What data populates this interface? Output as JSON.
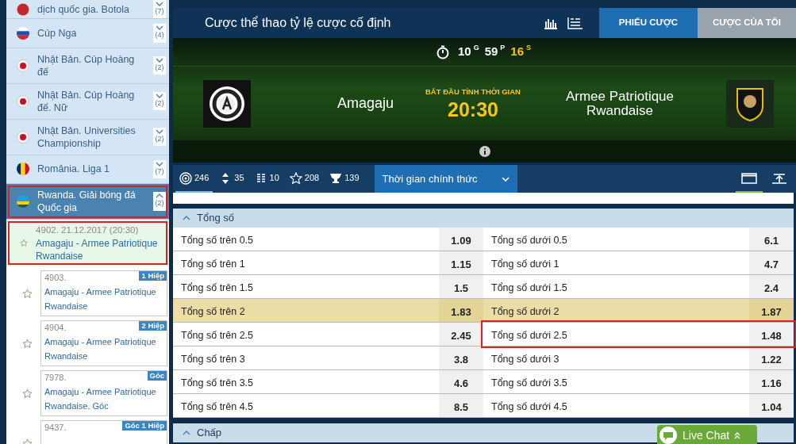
{
  "sidebar": {
    "leagues": [
      {
        "name": "dịch quốc gia. Botola",
        "count": "(7)",
        "kind": "morocco",
        "expanded": false,
        "selected": false,
        "outlined": false
      },
      {
        "name": "Cúp Nga",
        "count": "(4)",
        "kind": "russia",
        "expanded": false,
        "selected": false,
        "outlined": false
      },
      {
        "name": "Nhật Bản. Cúp Hoàng đế",
        "count": "(2)",
        "kind": "japan",
        "expanded": false,
        "selected": false,
        "outlined": false
      },
      {
        "name": "Nhật Bản. Cúp Hoàng đế. Nữ",
        "count": "(2)",
        "kind": "japan",
        "expanded": false,
        "selected": false,
        "outlined": false
      },
      {
        "name": "Nhật Bản. Universities Championship",
        "count": "(2)",
        "kind": "japan",
        "expanded": false,
        "selected": false,
        "outlined": false
      },
      {
        "name": "România. Liga 1",
        "count": "(7)",
        "kind": "romania",
        "expanded": false,
        "selected": false,
        "outlined": false
      },
      {
        "name": "Rwanda. Giải bóng đá Quốc gia",
        "count": "(2)",
        "kind": "rwanda",
        "expanded": true,
        "selected": true,
        "outlined": true
      }
    ],
    "main_match": {
      "code": "4902. 21.12.2017 (20:30)",
      "teams": "Amagaju - Armee Patriotique Rwandaise",
      "selected": true,
      "outlined": true
    },
    "sub_matches": [
      {
        "code": "4903.",
        "teams": "Amagaju - Armee Patriotique Rwandaise",
        "tag": "1 Hiệp"
      },
      {
        "code": "4904.",
        "teams": "Amagaju - Armee Patriotique Rwandaise",
        "tag": "2 Hiệp"
      },
      {
        "code": "7978.",
        "teams": "Amagaju - Armee Patriotique Rwandaise. Góc",
        "tag": "Góc"
      },
      {
        "code": "9437.",
        "tag": "Góc 1 Hiệp"
      }
    ]
  },
  "header": {
    "title": "Cược thể thao tỷ lệ cược cố định",
    "tabs": [
      {
        "label": "PHIẾU CƯỢC",
        "selected": true
      },
      {
        "label": "CƯỢC CỦA TÔI",
        "selected": false
      }
    ]
  },
  "banner": {
    "countdown": [
      {
        "value": "10",
        "unit": "G",
        "highlighted": false
      },
      {
        "value": "59",
        "unit": "P",
        "highlighted": false
      },
      {
        "value": "16",
        "unit": "S",
        "highlighted": true
      }
    ],
    "home": "Amagaju",
    "start_label": "BẮT ĐẦU TÍNH THỜI GIAN",
    "start_time": "20:30",
    "away": "Armee Patriotique Rwandaise"
  },
  "toolbar": {
    "stats": [
      {
        "kind": "target",
        "count": "246",
        "selected": true
      },
      {
        "kind": "updown",
        "count": "35",
        "selected": false
      },
      {
        "kind": "bars",
        "count": "10",
        "selected": false
      },
      {
        "kind": "star",
        "count": "208",
        "selected": false
      },
      {
        "kind": "trophy",
        "count": "139",
        "selected": false
      }
    ],
    "period": "Thời gian chính thức",
    "views": [
      {
        "kind": "window",
        "selected": true
      },
      {
        "kind": "upload",
        "selected": false
      }
    ]
  },
  "markets": [
    {
      "title": "Tổng số",
      "expanded": true,
      "rows": [
        {
          "highlighted": false,
          "left": {
            "label": "Tổng số trên 0.5",
            "odds": "1.09",
            "outlined": false
          },
          "right": {
            "label": "Tổng số dưới 0.5",
            "odds": "6.1",
            "outlined": false
          }
        },
        {
          "highlighted": false,
          "left": {
            "label": "Tổng số trên 1",
            "odds": "1.15",
            "outlined": false
          },
          "right": {
            "label": "Tổng số dưới 1",
            "odds": "4.7",
            "outlined": false
          }
        },
        {
          "highlighted": false,
          "left": {
            "label": "Tổng số trên 1.5",
            "odds": "1.5",
            "outlined": false
          },
          "right": {
            "label": "Tổng số dưới 1.5",
            "odds": "2.4",
            "outlined": false
          }
        },
        {
          "highlighted": true,
          "left": {
            "label": "Tổng số trên 2",
            "odds": "1.83",
            "outlined": false
          },
          "right": {
            "label": "Tổng số dưới 2",
            "odds": "1.87",
            "outlined": false
          }
        },
        {
          "highlighted": false,
          "left": {
            "label": "Tổng số trên 2.5",
            "odds": "2.45",
            "outlined": false
          },
          "right": {
            "label": "Tổng số dưới 2.5",
            "odds": "1.48",
            "outlined": true
          }
        },
        {
          "highlighted": false,
          "left": {
            "label": "Tổng số trên 3",
            "odds": "3.8",
            "outlined": false
          },
          "right": {
            "label": "Tổng số dưới 3",
            "odds": "1.22",
            "outlined": false
          }
        },
        {
          "highlighted": false,
          "left": {
            "label": "Tổng số trên 3.5",
            "odds": "4.6",
            "outlined": false
          },
          "right": {
            "label": "Tổng số dưới 3.5",
            "odds": "1.16",
            "outlined": false
          }
        },
        {
          "highlighted": false,
          "left": {
            "label": "Tổng số trên 4.5",
            "odds": "8.5",
            "outlined": false
          },
          "right": {
            "label": "Tổng số dưới 4.5",
            "odds": "1.04",
            "outlined": false
          }
        }
      ]
    },
    {
      "title": "Chấp",
      "expanded": true
    }
  ],
  "live_chat": {
    "label": "Live Chat"
  }
}
